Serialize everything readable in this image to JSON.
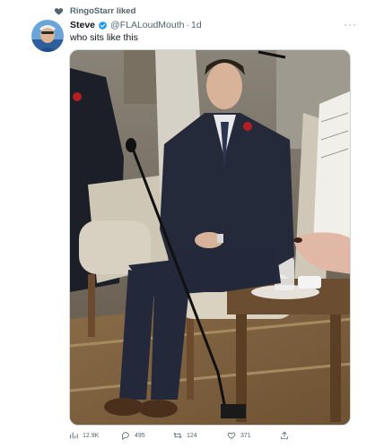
{
  "social_context": {
    "text": "RingoStarr liked",
    "icon": "heart-icon"
  },
  "tweet": {
    "display_name": "Steve",
    "handle": "@FLALoudMouth",
    "separator": "·",
    "time": "1d",
    "text": "who sits like this",
    "more_label": "···"
  },
  "actions": {
    "views": "12.9K",
    "replies": "495",
    "retweets": "124",
    "likes": "371"
  },
  "colors": {
    "text_primary": "#0f1419",
    "text_secondary": "#536471",
    "verified": "#1d9bf0",
    "border": "#cfd9de"
  }
}
